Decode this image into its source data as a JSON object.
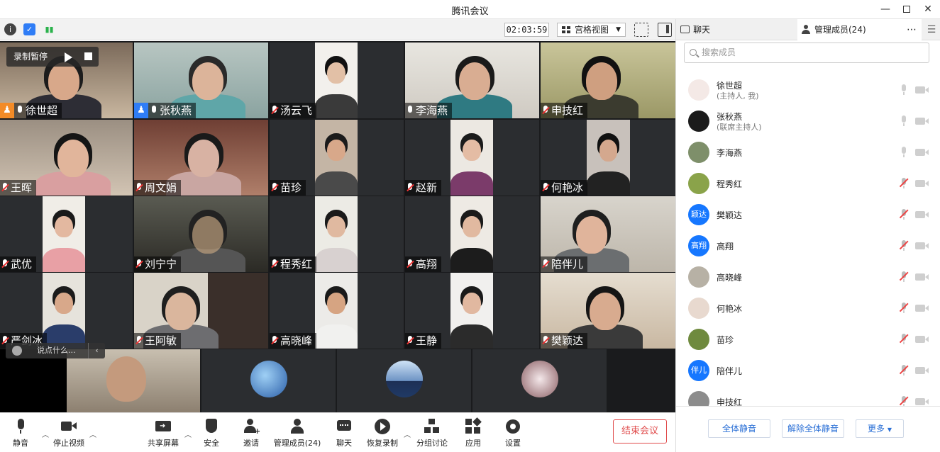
{
  "window": {
    "title": "腾讯会议"
  },
  "toolbar": {
    "timer": "02:03:59",
    "view_label": "宫格视图"
  },
  "recording": {
    "label": "录制暂停"
  },
  "chat_input": {
    "placeholder": "说点什么..."
  },
  "tiles": [
    {
      "name": "徐世超",
      "badge": "host",
      "muted": false
    },
    {
      "name": "张秋燕",
      "badge": "cohost",
      "muted": false
    },
    {
      "name": "汤云飞",
      "muted": true
    },
    {
      "name": "李海燕",
      "muted": false
    },
    {
      "name": "申技红",
      "muted": true
    },
    {
      "name": "王晖",
      "muted": true
    },
    {
      "name": "周文娟",
      "muted": true
    },
    {
      "name": "苗珍",
      "muted": true
    },
    {
      "name": "赵新",
      "muted": true
    },
    {
      "name": "何艳冰",
      "muted": true
    },
    {
      "name": "武优",
      "muted": true
    },
    {
      "name": "刘宁宁",
      "muted": true
    },
    {
      "name": "程秀红",
      "muted": true
    },
    {
      "name": "高翔",
      "muted": true
    },
    {
      "name": "陪伴儿",
      "muted": true
    },
    {
      "name": "严剑冰",
      "muted": true
    },
    {
      "name": "王阿敏",
      "muted": true
    },
    {
      "name": "高晓峰",
      "muted": true
    },
    {
      "name": "王静",
      "muted": true
    },
    {
      "name": "樊颖达",
      "muted": true
    }
  ],
  "bottom_bar": {
    "mute": "静音",
    "stop_video": "停止视频",
    "share_screen": "共享屏幕",
    "security": "安全",
    "invite": "邀请",
    "manage_members": "管理成员(24)",
    "chat": "聊天",
    "resume_recording": "恢复录制",
    "breakout": "分组讨论",
    "apps": "应用",
    "settings": "设置",
    "end_meeting": "结束会议"
  },
  "panel": {
    "tab_chat": "聊天",
    "tab_members": "管理成员(24)",
    "search_placeholder": "搜索成员",
    "members": [
      {
        "name": "徐世超",
        "role": "(主持人, 我)",
        "muted": false,
        "avatar_color": "#f4e9e6"
      },
      {
        "name": "张秋燕",
        "role": "(联席主持人)",
        "muted": false,
        "avatar_color": "#1b1b1b"
      },
      {
        "name": "李海燕",
        "role": "",
        "muted": false,
        "avatar_color": "#7e8f6a"
      },
      {
        "name": "程秀红",
        "role": "",
        "muted": true,
        "avatar_color": "#8aa34a"
      },
      {
        "name": "樊颖达",
        "role": "",
        "muted": true,
        "avatar_color": "#1677ff",
        "avatar_text": "颖达"
      },
      {
        "name": "高翔",
        "role": "",
        "muted": true,
        "avatar_color": "#1677ff",
        "avatar_text": "高翔"
      },
      {
        "name": "高晓峰",
        "role": "",
        "muted": true,
        "avatar_color": "#b7b1a5"
      },
      {
        "name": "何艳冰",
        "role": "",
        "muted": true,
        "avatar_color": "#e8d9cf"
      },
      {
        "name": "苗珍",
        "role": "",
        "muted": true,
        "avatar_color": "#6f8a3e"
      },
      {
        "name": "陪伴儿",
        "role": "",
        "muted": true,
        "avatar_color": "#1677ff",
        "avatar_text": "伴儿"
      },
      {
        "name": "申技红",
        "role": "",
        "muted": true,
        "avatar_color": "#8c8c8c"
      }
    ],
    "mute_all": "全体静音",
    "unmute_all": "解除全体静音",
    "more": "更多"
  }
}
